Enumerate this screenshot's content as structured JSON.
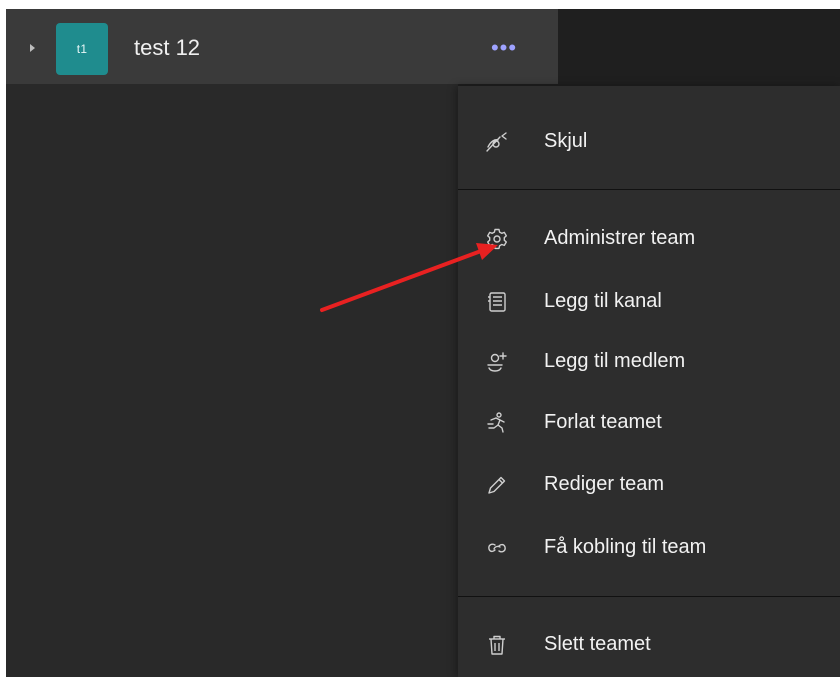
{
  "team": {
    "avatar_text": "t1",
    "name": "test 12",
    "more_label": "•••"
  },
  "menu": {
    "items": [
      {
        "label": "Skjul",
        "icon": "hide-icon"
      },
      {
        "label": "Administrer team",
        "icon": "gear-icon"
      },
      {
        "label": "Legg til kanal",
        "icon": "channel-icon"
      },
      {
        "label": "Legg til medlem",
        "icon": "add-member-icon"
      },
      {
        "label": "Forlat teamet",
        "icon": "leave-icon"
      },
      {
        "label": "Rediger team",
        "icon": "pencil-icon"
      },
      {
        "label": "Få kobling til team",
        "icon": "link-icon"
      },
      {
        "label": "Slett teamet",
        "icon": "trash-icon"
      }
    ]
  },
  "annotation": {
    "arrow_color": "#e82121"
  },
  "colors": {
    "background": "#1f1f1f",
    "left_pane": "#292929",
    "menu_background": "#2d2d2d",
    "avatar": "#1f8c8e",
    "more_dots": "#9ea2ff"
  }
}
